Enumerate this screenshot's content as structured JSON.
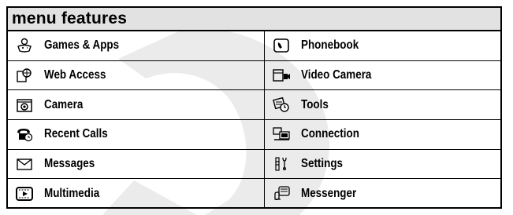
{
  "title": "menu features",
  "watermark_letter": "D",
  "watermark_color": "#ebebeb",
  "items": [
    {
      "label": "Games & Apps",
      "icon": "games-apps-icon"
    },
    {
      "label": "Phonebook",
      "icon": "phonebook-icon"
    },
    {
      "label": "Web Access",
      "icon": "web-access-icon"
    },
    {
      "label": "Video Camera",
      "icon": "video-camera-icon"
    },
    {
      "label": "Camera",
      "icon": "camera-icon"
    },
    {
      "label": "Tools",
      "icon": "tools-icon"
    },
    {
      "label": "Recent Calls",
      "icon": "recent-calls-icon"
    },
    {
      "label": "Connection",
      "icon": "connection-icon"
    },
    {
      "label": "Messages",
      "icon": "messages-icon"
    },
    {
      "label": "Settings",
      "icon": "settings-icon"
    },
    {
      "label": "Multimedia",
      "icon": "multimedia-icon"
    },
    {
      "label": "Messenger",
      "icon": "messenger-icon"
    }
  ]
}
